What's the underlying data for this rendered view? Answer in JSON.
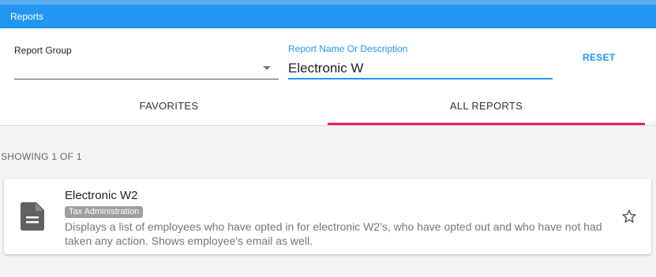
{
  "app": {
    "title": "Reports",
    "accent": "#2196f3",
    "tab_indicator": "#e91e63"
  },
  "filters": {
    "report_group_label": "Report Group",
    "report_group_value": "",
    "report_name_label": "Report Name Or Description",
    "report_name_value": "Electronic W",
    "reset_label": "RESET"
  },
  "tabs": [
    {
      "label": "FAVORITES",
      "active": false
    },
    {
      "label": "ALL REPORTS",
      "active": true
    }
  ],
  "results": {
    "showing_text": "SHOWING 1 OF 1",
    "items": [
      {
        "icon": "document-icon",
        "title": "Electronic W2",
        "category": "Tax Administration",
        "description": "Displays a list of employees who have opted in for electronic W2's, who have opted out and who have not had taken any action. Shows employee's email as well.",
        "favorite": false,
        "favorite_icon": "star-outline-icon"
      }
    ]
  }
}
